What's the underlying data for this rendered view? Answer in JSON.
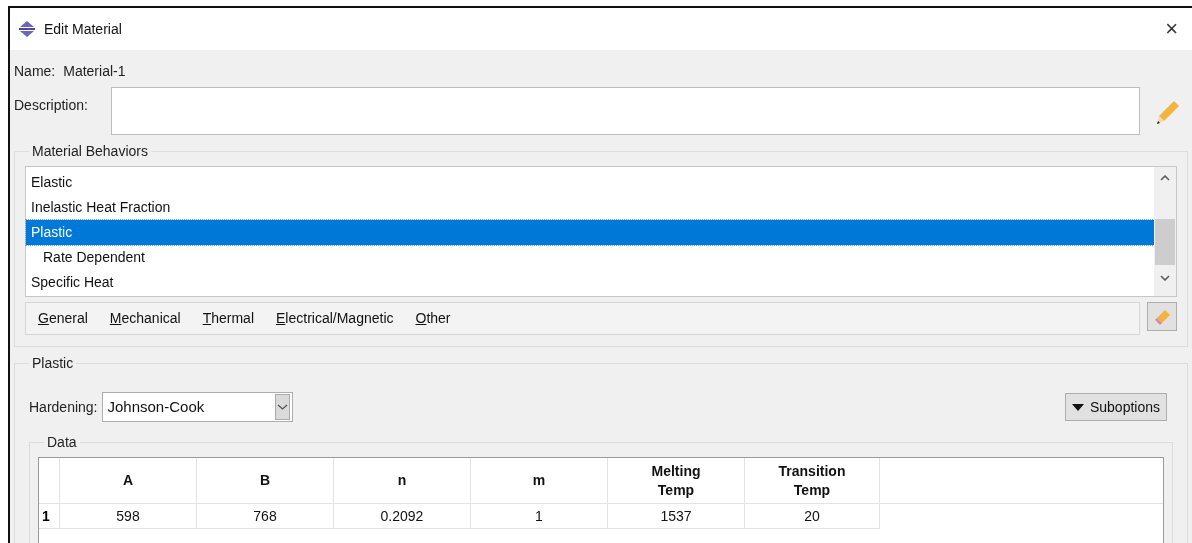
{
  "window": {
    "title": "Edit Material",
    "close": "×"
  },
  "name": {
    "label": "Name:",
    "value": "Material-1"
  },
  "description": {
    "label": "Description:"
  },
  "material_behaviors": {
    "title": "Material Behaviors",
    "items": [
      {
        "label": "Elastic",
        "selected": false
      },
      {
        "label": "Inelastic Heat Fraction",
        "selected": false
      },
      {
        "label": "Plastic",
        "selected": true,
        "children": [
          {
            "label": "Rate Dependent",
            "selected": false
          }
        ]
      },
      {
        "label": "Specific Heat",
        "selected": false
      }
    ],
    "menu": [
      "General",
      "Mechanical",
      "Thermal",
      "Electrical/Magnetic",
      "Other"
    ]
  },
  "plastic": {
    "title": "Plastic",
    "hardening": {
      "label": "Hardening:",
      "value": "Johnson-Cook"
    },
    "suboptions": "Suboptions",
    "data": {
      "title": "Data",
      "columns": [
        "A",
        "B",
        "n",
        "m",
        "Melting Temp",
        "Transition Temp"
      ],
      "rows": [
        {
          "index": "1",
          "cells": [
            "598",
            "768",
            "0.2092",
            "1",
            "1537",
            "20"
          ]
        }
      ]
    }
  }
}
